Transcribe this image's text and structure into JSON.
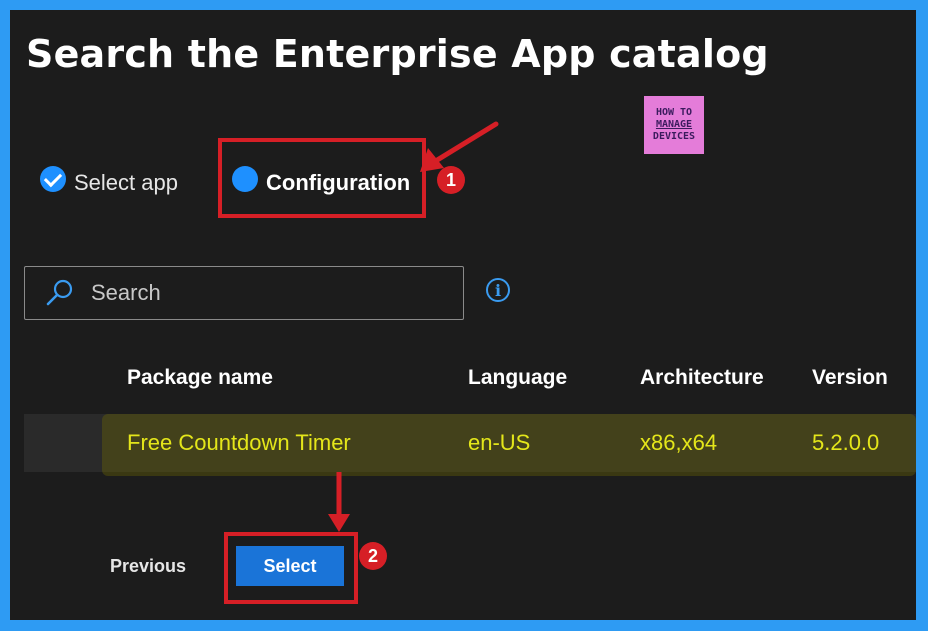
{
  "page": {
    "title": "Search the Enterprise App catalog"
  },
  "logo": {
    "line1": "HOW TO",
    "line2": "MANAGE",
    "line3": "DEVICES"
  },
  "steps": [
    {
      "label": "Select app",
      "state": "completed",
      "icon": "checkmark-circle-icon"
    },
    {
      "label": "Configuration",
      "state": "current",
      "icon": "filled-circle-icon"
    }
  ],
  "search": {
    "placeholder": "Search",
    "icon": "search-icon",
    "info_icon": "info-icon"
  },
  "table": {
    "headers": [
      "Package name",
      "Language",
      "Architecture",
      "Version"
    ],
    "rows": [
      [
        "Free Countdown Timer",
        "en-US",
        "x86,x64",
        "5.2.0.0"
      ]
    ],
    "highlight_color": "#e4e61a"
  },
  "footer": {
    "previous_label": "Previous",
    "select_label": "Select"
  },
  "annotations": {
    "badge1": "1",
    "badge2": "2",
    "color": "#d61f26"
  },
  "colors": {
    "accent": "#1e90ff",
    "button": "#1a74d8",
    "frame": "#2e9bf3"
  }
}
